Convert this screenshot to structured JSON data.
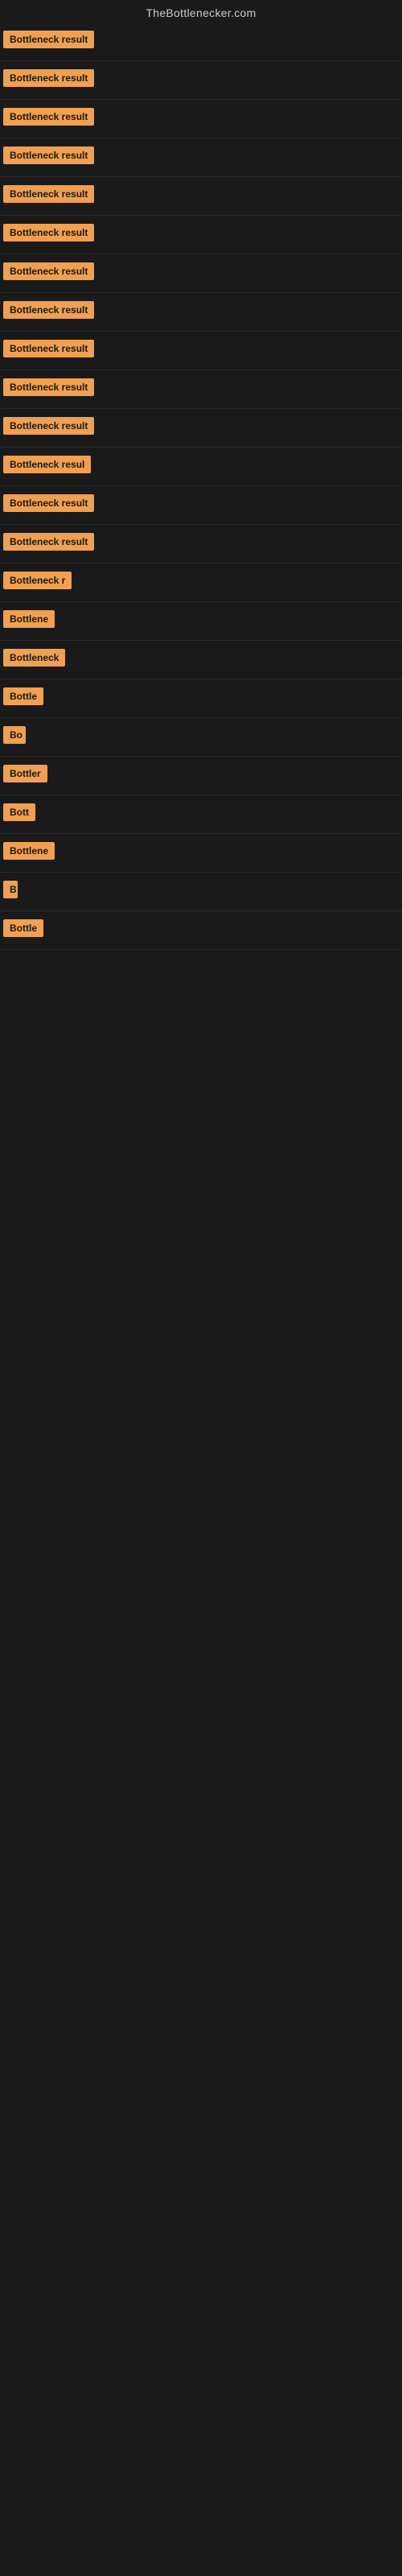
{
  "site": {
    "title": "TheBottlenecker.com"
  },
  "items": [
    {
      "id": 1,
      "label": "Bottleneck result",
      "width": 120
    },
    {
      "id": 2,
      "label": "Bottleneck result",
      "width": 120
    },
    {
      "id": 3,
      "label": "Bottleneck result",
      "width": 120
    },
    {
      "id": 4,
      "label": "Bottleneck result",
      "width": 120
    },
    {
      "id": 5,
      "label": "Bottleneck result",
      "width": 120
    },
    {
      "id": 6,
      "label": "Bottleneck result",
      "width": 120
    },
    {
      "id": 7,
      "label": "Bottleneck result",
      "width": 120
    },
    {
      "id": 8,
      "label": "Bottleneck result",
      "width": 120
    },
    {
      "id": 9,
      "label": "Bottleneck result",
      "width": 120
    },
    {
      "id": 10,
      "label": "Bottleneck result",
      "width": 120
    },
    {
      "id": 11,
      "label": "Bottleneck result",
      "width": 120
    },
    {
      "id": 12,
      "label": "Bottleneck resul",
      "width": 110
    },
    {
      "id": 13,
      "label": "Bottleneck result",
      "width": 120
    },
    {
      "id": 14,
      "label": "Bottleneck result",
      "width": 118
    },
    {
      "id": 15,
      "label": "Bottleneck r",
      "width": 85
    },
    {
      "id": 16,
      "label": "Bottlene",
      "width": 70
    },
    {
      "id": 17,
      "label": "Bottleneck",
      "width": 78
    },
    {
      "id": 18,
      "label": "Bottle",
      "width": 55
    },
    {
      "id": 19,
      "label": "Bo",
      "width": 28
    },
    {
      "id": 20,
      "label": "Bottler",
      "width": 56
    },
    {
      "id": 21,
      "label": "Bott",
      "width": 40
    },
    {
      "id": 22,
      "label": "Bottlene",
      "width": 65
    },
    {
      "id": 23,
      "label": "B",
      "width": 18
    },
    {
      "id": 24,
      "label": "Bottle",
      "width": 52
    }
  ]
}
